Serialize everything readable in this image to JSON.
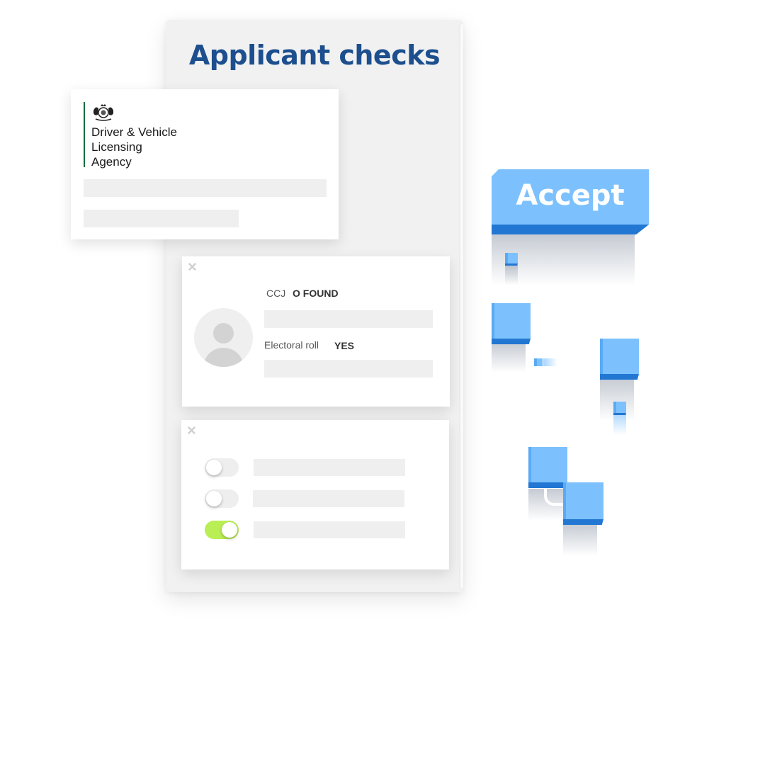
{
  "panel": {
    "title": "Applicant checks"
  },
  "dvla": {
    "lines": [
      "Driver & Vehicle",
      "Licensing",
      "Agency"
    ],
    "accent_color": "#00703c"
  },
  "checks": {
    "ccj": {
      "label": "CCJ",
      "value": "O FOUND"
    },
    "electoral_roll": {
      "label": "Electoral roll",
      "value": "YES"
    }
  },
  "toggles": [
    {
      "on": false
    },
    {
      "on": false
    },
    {
      "on": true
    }
  ],
  "accept_button": {
    "label": "Accept",
    "color": "#7cc1fd"
  },
  "icons": {
    "close": "×"
  }
}
